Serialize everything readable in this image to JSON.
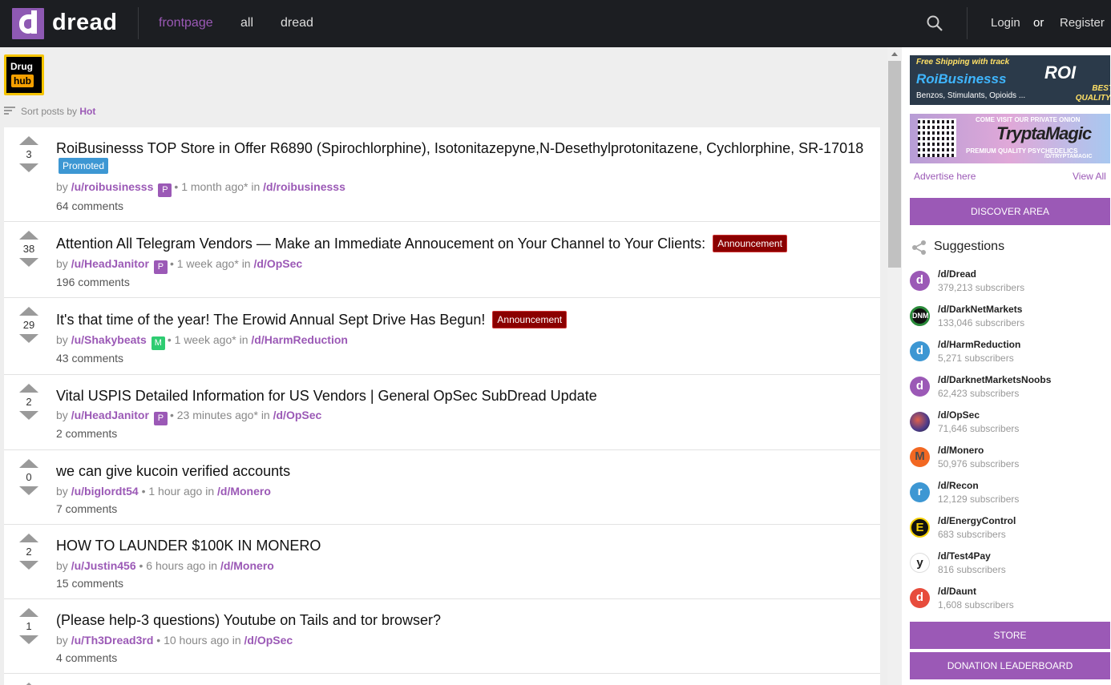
{
  "header": {
    "logo_letter": "d",
    "logo_text": "dread",
    "nav": [
      {
        "label": "frontpage",
        "active": true
      },
      {
        "label": "all",
        "active": false
      },
      {
        "label": "dread",
        "active": false
      }
    ],
    "login": "Login",
    "or": "or",
    "register": "Register"
  },
  "brand": {
    "line1": "Drug",
    "line2": "hub"
  },
  "sort": {
    "prefix": "Sort posts by",
    "value": "Hot"
  },
  "posts": [
    {
      "score": "3",
      "title": "RoiBusinesss TOP Store in Offer R6890 (Spirochlorphine), Isotonitazepyne,N-Desethylprotonitazene, Cychlorphine, SR-17018",
      "tag": "Promoted",
      "by": "by",
      "user": "/u/roibusinesss",
      "badge": "P",
      "time": "1 month ago*",
      "in": "in",
      "sub": "/d/roibusinesss",
      "comments": "64 comments"
    },
    {
      "score": "38",
      "title": "Attention All Telegram Vendors — Make an Immediate Annoucement on Your Channel to Your Clients:",
      "tag": "Announcement",
      "by": "by",
      "user": "/u/HeadJanitor",
      "badge": "P",
      "time": "1 week ago*",
      "in": "in",
      "sub": "/d/OpSec",
      "comments": "196 comments"
    },
    {
      "score": "29",
      "title": "It's that time of the year! The Erowid Annual Sept Drive Has Begun!",
      "tag": "Announcement",
      "by": "by",
      "user": "/u/Shakybeats",
      "badge": "M",
      "time": "1 week ago*",
      "in": "in",
      "sub": "/d/HarmReduction",
      "comments": "43 comments"
    },
    {
      "score": "2",
      "title": "Vital USPIS Detailed Information for US Vendors | General OpSec SubDread Update",
      "by": "by",
      "user": "/u/HeadJanitor",
      "badge": "P",
      "time": "23 minutes ago*",
      "in": "in",
      "sub": "/d/OpSec",
      "comments": "2 comments"
    },
    {
      "score": "0",
      "title": "we can give kucoin verified accounts",
      "by": "by",
      "user": "/u/biglordt54",
      "time": "1 hour ago",
      "in": "in",
      "sub": "/d/Monero",
      "comments": "7 comments"
    },
    {
      "score": "2",
      "title": "HOW TO LAUNDER $100K IN MONERO",
      "by": "by",
      "user": "/u/Justin456",
      "time": "6 hours ago",
      "in": "in",
      "sub": "/d/Monero",
      "comments": "15 comments"
    },
    {
      "score": "1",
      "title": "(Please help-3 questions) Youtube on Tails and tor browser?",
      "by": "by",
      "user": "/u/Th3Dread3rd",
      "time": "10 hours ago",
      "in": "in",
      "sub": "/d/OpSec",
      "comments": "4 comments"
    }
  ],
  "sidebar": {
    "banner1": {
      "line1": "Free Shipping with track",
      "name": "RoiBusinesss",
      "products": "Benzos, Stimulants, Opioids ...",
      "roi": "ROI",
      "quality": "BEST QUALITY!"
    },
    "banner2": {
      "line1": "COME VISIT OUR PRIVATE ONION",
      "name": "TryptaMagic",
      "line2": "PREMIUM QUALITY PSYCHEDELICS",
      "line3": "/D/TRYPTAMAGIC"
    },
    "advertise": "Advertise here",
    "view_all": "View All",
    "discover": "DISCOVER AREA",
    "suggestions_title": "Suggestions",
    "suggestions": [
      {
        "name": "/d/Dread",
        "subs": "379,213 subscribers",
        "color": "#9b59b6",
        "glyph": "d"
      },
      {
        "name": "/d/DarkNetMarkets",
        "subs": "133,046 subscribers",
        "color": "#1a6b2a",
        "glyph": "D"
      },
      {
        "name": "/d/HarmReduction",
        "subs": "5,271 subscribers",
        "color": "#3d97d3",
        "glyph": "d"
      },
      {
        "name": "/d/DarknetMarketsNoobs",
        "subs": "62,423 subscribers",
        "color": "#9b59b6",
        "glyph": "d"
      },
      {
        "name": "/d/OpSec",
        "subs": "71,646 subscribers",
        "color": "#5a4aa0",
        "glyph": "o"
      },
      {
        "name": "/d/Monero",
        "subs": "50,976 subscribers",
        "color": "#f26822",
        "glyph": "M"
      },
      {
        "name": "/d/Recon",
        "subs": "12,129 subscribers",
        "color": "#3d97d3",
        "glyph": "r"
      },
      {
        "name": "/d/EnergyControl",
        "subs": "683 subscribers",
        "color": "#111111",
        "glyph": "E"
      },
      {
        "name": "/d/Test4Pay",
        "subs": "816 subscribers",
        "color": "#ffffff",
        "glyph": "y"
      },
      {
        "name": "/d/Daunt",
        "subs": "1,608 subscribers",
        "color": "#e74c3c",
        "glyph": "d"
      }
    ],
    "store": "STORE",
    "donation": "DONATION LEADERBOARD"
  },
  "colors": {
    "accent": "#9b59b6",
    "header_bg": "#1c1e22",
    "announce": "#8b0000",
    "promoted": "#3d97d3"
  }
}
